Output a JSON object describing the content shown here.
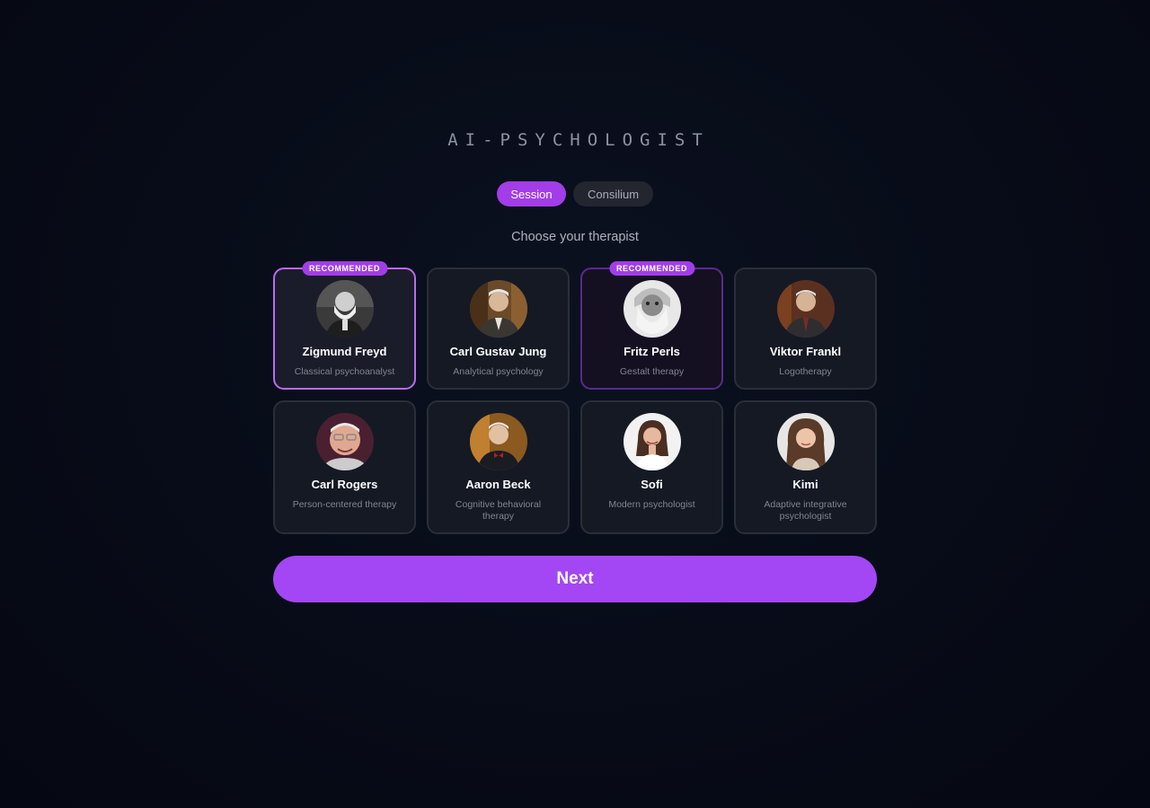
{
  "app": {
    "logo": "AI-PSYCHOLOGIST"
  },
  "modes": [
    {
      "label": "Session",
      "active": true
    },
    {
      "label": "Consilium",
      "active": false
    }
  ],
  "prompt": "Choose your therapist",
  "badge_label": "RECOMMENDED",
  "therapists": [
    {
      "name": "Zigmund Freyd",
      "specialty": "Classical psychoanalyst",
      "recommended": true,
      "selected": true,
      "avatar": "bw-bearded-elder-portrait"
    },
    {
      "name": "Carl Gustav Jung",
      "specialty": "Analytical psychology",
      "recommended": false,
      "selected": false,
      "avatar": "elder-man-portrait"
    },
    {
      "name": "Fritz Perls",
      "specialty": "Gestalt therapy",
      "recommended": true,
      "selected": false,
      "avatar": "bw-white-beard-portrait"
    },
    {
      "name": "Viktor Frankl",
      "specialty": "Logotherapy",
      "recommended": false,
      "selected": false,
      "avatar": "elder-man-suit-portrait"
    },
    {
      "name": "Carl Rogers",
      "specialty": "Person-centered therapy",
      "recommended": false,
      "selected": false,
      "avatar": "elder-man-glasses-portrait"
    },
    {
      "name": "Aaron Beck",
      "specialty": "Cognitive behavioral therapy",
      "recommended": false,
      "selected": false,
      "avatar": "elder-man-bowtie-portrait"
    },
    {
      "name": "Sofi",
      "specialty": "Modern psychologist",
      "recommended": false,
      "selected": false,
      "avatar": "young-woman-portrait"
    },
    {
      "name": "Kimi",
      "specialty": "Adaptive integrative psychologist",
      "recommended": false,
      "selected": false,
      "avatar": "young-woman-curly-portrait"
    }
  ],
  "next_label": "Next",
  "colors": {
    "accent": "#a23de8",
    "background": "#070b17"
  }
}
